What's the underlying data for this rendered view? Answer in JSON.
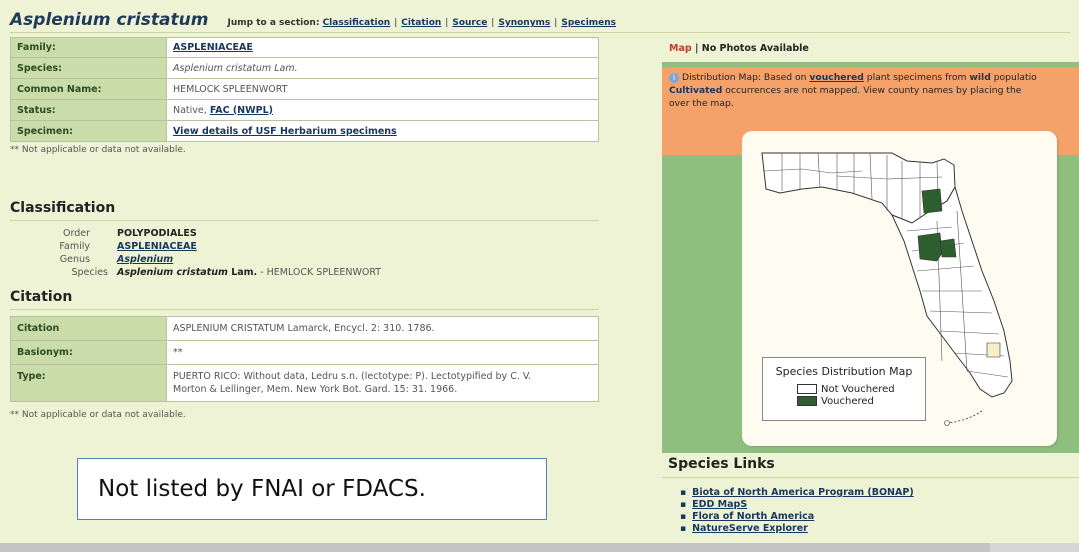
{
  "header": {
    "species_title": "Asplenium cristatum",
    "jump_prefix": "Jump to a section:",
    "jump_links": [
      "Classification",
      "Citation",
      "Source",
      "Synonyms",
      "Specimens"
    ]
  },
  "summary_table": [
    {
      "label": "Family:",
      "value": "ASPLENIACEAE",
      "link": true
    },
    {
      "label": "Species:",
      "value": "Asplenium cristatum Lam.",
      "link": false
    },
    {
      "label": "Common Name:",
      "value": "HEMLOCK SPLEENWORT",
      "link": false
    },
    {
      "label": "Status:",
      "value_prefix": "Native, ",
      "value_link": "FAC (NWPL)"
    },
    {
      "label": "Specimen:",
      "value": "View details of USF Herbarium specimens",
      "link": true
    }
  ],
  "note_1": "** Not applicable or data not available.",
  "classification": {
    "title": "Classification",
    "rows": [
      {
        "rank": "Order",
        "value": "POLYPODIALES"
      },
      {
        "rank": "Family",
        "value": "ASPLENIACEAE"
      },
      {
        "rank": "Genus",
        "value": "Asplenium"
      },
      {
        "rank": "Species",
        "value_main": "Asplenium cristatum",
        "value_author": " Lam.",
        "value_common": " - HEMLOCK SPLEENWORT"
      }
    ]
  },
  "citation": {
    "title": "Citation",
    "rows": [
      {
        "label": "Citation",
        "value": "ASPLENIUM CRISTATUM Lamarck, Encycl. 2: 310. 1786."
      },
      {
        "label": "Basionym:",
        "value": "**"
      },
      {
        "label": "Type:",
        "value_line1": "PUERTO RICO: Without data, Ledru s.n. (lectotype: P). Lectotypified by C. V.",
        "value_line2": "Morton & Lellinger, Mem. New York Bot. Gard. 15: 31. 1966."
      }
    ]
  },
  "note_2": "** Not applicable or data not available.",
  "listed_note": "Not listed by FNAI or FDACS.",
  "map_panel": {
    "tab_map": "Map",
    "tab_sep": " | ",
    "tab_photos": "No Photos Available",
    "dist_line1_a": "Distribution Map: Based on ",
    "dist_line1_link": "vouchered",
    "dist_line1_b": " plant specimens from ",
    "dist_line1_bold": "wild",
    "dist_line1_c": " populatio",
    "dist_line2_bold": "Cultivated",
    "dist_line2_rest": " occurrences are not mapped. View county names by placing the",
    "dist_line3": "over the map.",
    "legend_title": "Species Distribution Map",
    "legend_not": "Not Vouchered",
    "legend_yes": "Vouchered",
    "colors": {
      "vouchered": "#2e5e2e",
      "not_vouchered": "#ffffff"
    }
  },
  "species_links": {
    "title": "Species Links",
    "items": [
      "Biota of North America Program (BONAP)",
      "EDD MapS",
      "Flora of North America",
      "NatureServe Explorer"
    ]
  }
}
